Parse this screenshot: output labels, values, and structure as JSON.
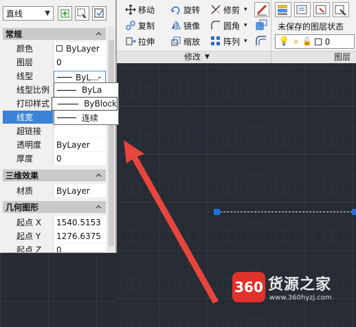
{
  "palette": {
    "object_type": "直线",
    "sections": {
      "general": "常规",
      "3d": "三维效果",
      "geometry": "几何图形"
    },
    "general_rows": [
      {
        "key": "颜色",
        "value": "ByLayer"
      },
      {
        "key": "图层",
        "value": "0"
      },
      {
        "key": "线型",
        "value": "—— ByL..."
      },
      {
        "key": "线型比例",
        "value": ""
      },
      {
        "key": "打印样式",
        "value": ""
      },
      {
        "key": "线宽",
        "value": ""
      },
      {
        "key": "超链接",
        "value": ""
      },
      {
        "key": "透明度",
        "value": "ByLayer"
      },
      {
        "key": "厚度",
        "value": "0"
      }
    ],
    "three_d_rows": [
      {
        "key": "材质",
        "value": "ByLayer"
      }
    ],
    "geometry_rows": [
      {
        "key": "起点 X",
        "value": "1540.5153"
      },
      {
        "key": "起点 Y",
        "value": "1276.6375"
      },
      {
        "key": "起点 Z",
        "value": "0"
      }
    ],
    "linetype_selected": "ByL...",
    "linetype_options": [
      "ByLa",
      "ByBlock",
      "连续"
    ]
  },
  "ribbon": {
    "modify": {
      "move": "移动",
      "rotate": "旋转",
      "trim": "修剪",
      "copy": "复制",
      "mirror": "镜像",
      "fillet": "圆角",
      "stretch": "拉伸",
      "scale": "缩放",
      "array": "阵列",
      "panel_title": "修改",
      "panel_arrow": "▼"
    },
    "layers": {
      "state": "未保存的图层状态",
      "current_layer": "0",
      "panel_title": "图层"
    }
  },
  "watermark": {
    "badge": "360",
    "title": "货源之家",
    "url": "www.360hyzj.com"
  },
  "colors": {
    "canvas": "#262b34",
    "selection": "#3b83d6",
    "grip": "#1f6fe0",
    "arrow": "#e8453c"
  }
}
